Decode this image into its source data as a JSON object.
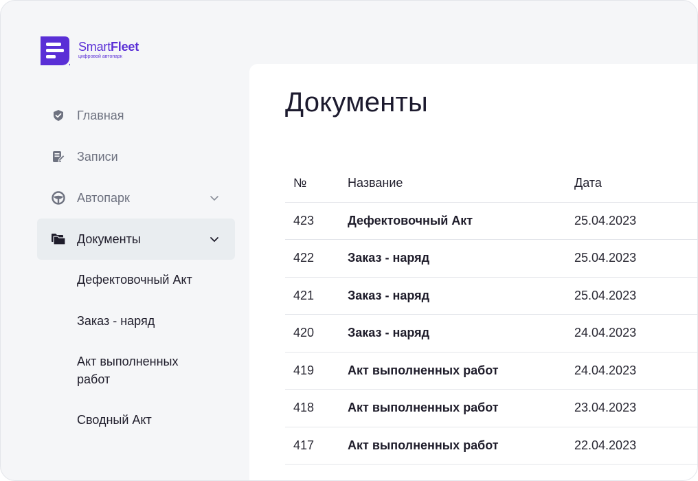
{
  "brand": {
    "name_regular": "Smart",
    "name_bold": "Fleet",
    "tagline": "цифровой автопарк",
    "accent_color": "#5a2fd6"
  },
  "sidebar": {
    "items": [
      {
        "label": "Главная",
        "icon": "shield-check-icon"
      },
      {
        "label": "Записи",
        "icon": "edit-document-icon"
      },
      {
        "label": "Автопарк",
        "icon": "steering-wheel-icon",
        "has_chevron": true
      },
      {
        "label": "Документы",
        "icon": "folder-icon",
        "has_chevron": true,
        "active": true
      }
    ],
    "subitems": [
      "Дефектовочный Акт",
      "Заказ - наряд",
      "Акт выполненных\nработ",
      "Сводный Акт"
    ]
  },
  "main": {
    "title": "Документы",
    "columns": [
      "№",
      "Название",
      "Дата"
    ],
    "rows": [
      {
        "num": "423",
        "name": "Дефектовочный Акт",
        "date": "25.04.2023"
      },
      {
        "num": "422",
        "name": "Заказ - наряд",
        "date": "25.04.2023"
      },
      {
        "num": "421",
        "name": "Заказ - наряд",
        "date": "25.04.2023"
      },
      {
        "num": "420",
        "name": "Заказ - наряд",
        "date": "24.04.2023"
      },
      {
        "num": "419",
        "name": "Акт выполненных работ",
        "date": "24.04.2023"
      },
      {
        "num": "418",
        "name": "Акт выполненных работ",
        "date": "23.04.2023"
      },
      {
        "num": "417",
        "name": "Акт выполненных работ",
        "date": "22.04.2023"
      }
    ]
  }
}
